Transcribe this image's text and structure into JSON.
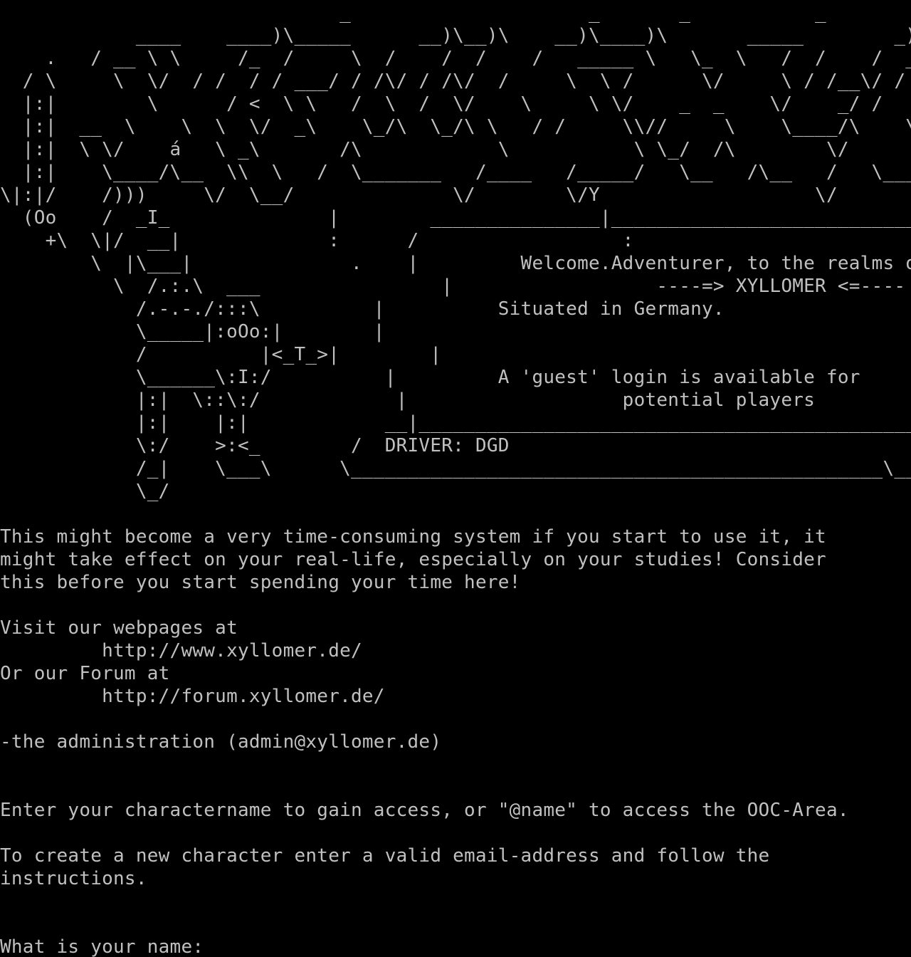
{
  "colors": {
    "background": "#000000",
    "foreground": "#c0c0c0"
  },
  "banner": [
    "                              _                     _       _           _           _                            _                     _                   _",
    "            ____    ____)\\_____      __)\\__)\\    __)\\____)\\       _____        _)\\        _____)\\__________)\\",
    "    .   / __ \\ \\     /_  /     \\  /    /  /    /   _____ \\   \\_  \\   /  /    /  __  /_   ____  /",
    "  / \\     \\  \\/  / /  / / ___/ / /\\/ / /\\/  /     \\  \\ /      \\/     \\ / /__\\/ /  /__/ /",
    "  |:|        \\      / <  \\ \\   /  \\  /  \\/    \\     \\ \\/    _  _    \\/    _/ /   \\\\  /",
    "  |:|  __  \\    \\  \\  \\/  _\\    \\_/\\  \\_/\\ \\   / /     \\\\//     \\    \\____/\\    \\\\ \\/\\",
    "  |:|  \\ \\/    á   \\ _\\       /\\            \\           \\ \\_/  /\\        \\/         /\\           \\     \\\\    \\",
    "  |:|    \\____/\\__  \\\\  \\   /  \\_______   /____   /_____/   \\__   /\\__   /   \\_______   /_   / \\  /",
    "\\|:|/    /)))     \\/  \\__/              \\/        \\/Y                   \\/        \\/              \\/  Y\\/     \\/",
    "  (Oo    /  _I_              |        _______________|________________________________|______",
    "    +\\  \\|/  __|             :      /                  :                                                 :   /   \\",
    "        \\  |\\___|              .    |         Welcome.Adventurer, to the realms of     .  |____|",
    "          \\  /.:.\\  ___                |                  ----=> XYLLOMER <=----                 |",
    "            /.-.-./:::\\          |          Situated in Germany.                            |",
    "            \\_____|:oOo:|        |                                                             |",
    "            /          |<_T_>|        |                                                             |",
    "            \\______\\:I:/          |         A 'guest' login is available for        |",
    "            |:|  \\::\\:/            |                   potential players                     |________",
    "            |:|    |:|            __|_______________________________________________     |->Red<-|",
    "            \\:/    >:<_        /  DRIVER: DGD                                                  /      |Phoenix|",
    "            /_|    \\___\\      \\_______________________________________________\\__/   ~~~~~~~~",
    "            \\_/"
  ],
  "body": [
    "This might become a very time-consuming system if you start to use it, it",
    "might take effect on your real-life, especially on your studies! Consider",
    "this before you start spending your time here!",
    "Visit our webpages at",
    "         http://www.xyllomer.de/",
    "Or our Forum at",
    "         http://forum.xyllomer.de/",
    "-the administration (admin@xyllomer.de)",
    "Enter your charactername to gain access, or \"@name\" to access the OOC-Area.",
    "To create a new character enter a valid email-address and follow the",
    "instructions."
  ],
  "prompt": {
    "label": "What is your name: "
  }
}
